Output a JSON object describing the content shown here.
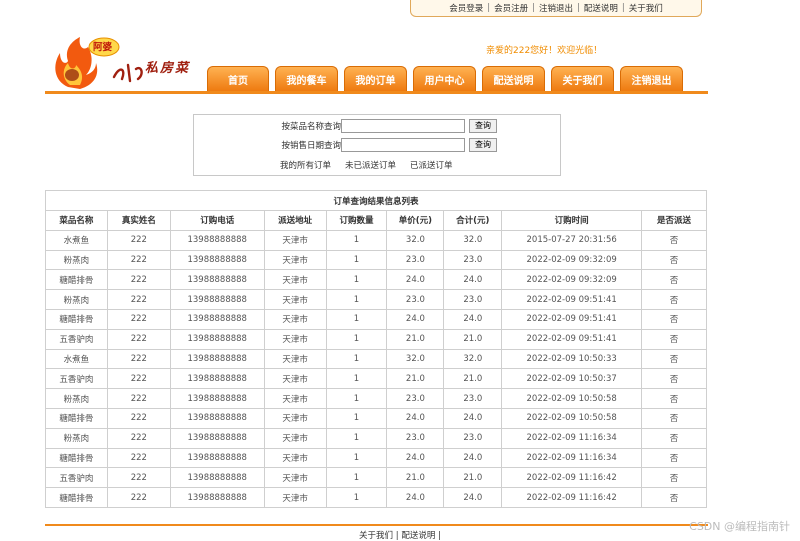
{
  "top_links": [
    "会员登录",
    "会员注册",
    "注销退出",
    "配送说明",
    "关于我们"
  ],
  "logo": {
    "badge": "阿婆",
    "brand": "私房菜"
  },
  "welcome": "亲爱的222您好！欢迎光临！",
  "nav": [
    "首页",
    "我的餐车",
    "我的订单",
    "用户中心",
    "配送说明",
    "关于我们",
    "注销退出"
  ],
  "search": {
    "by_name_label": "按菜品名称查询",
    "by_date_label": "按销售日期查询",
    "name_value": "",
    "date_value": "",
    "button": "查询",
    "links": [
      "我的所有订单",
      "未已派送订单",
      "已派送订单"
    ]
  },
  "table": {
    "caption": "订单查询结果信息列表",
    "headers": [
      "菜品名称",
      "真实姓名",
      "订购电话",
      "派送地址",
      "订购数量",
      "单价(元)",
      "合计(元)",
      "订购时间",
      "是否派送"
    ],
    "rows": [
      [
        "水煮鱼",
        "222",
        "13988888888",
        "天津市",
        "1",
        "32.0",
        "32.0",
        "2015-07-27 20:31:56",
        "否"
      ],
      [
        "粉蒸肉",
        "222",
        "13988888888",
        "天津市",
        "1",
        "23.0",
        "23.0",
        "2022-02-09 09:32:09",
        "否"
      ],
      [
        "糖醋排骨",
        "222",
        "13988888888",
        "天津市",
        "1",
        "24.0",
        "24.0",
        "2022-02-09 09:32:09",
        "否"
      ],
      [
        "粉蒸肉",
        "222",
        "13988888888",
        "天津市",
        "1",
        "23.0",
        "23.0",
        "2022-02-09 09:51:41",
        "否"
      ],
      [
        "糖醋排骨",
        "222",
        "13988888888",
        "天津市",
        "1",
        "24.0",
        "24.0",
        "2022-02-09 09:51:41",
        "否"
      ],
      [
        "五香驴肉",
        "222",
        "13988888888",
        "天津市",
        "1",
        "21.0",
        "21.0",
        "2022-02-09 09:51:41",
        "否"
      ],
      [
        "水煮鱼",
        "222",
        "13988888888",
        "天津市",
        "1",
        "32.0",
        "32.0",
        "2022-02-09 10:50:33",
        "否"
      ],
      [
        "五香驴肉",
        "222",
        "13988888888",
        "天津市",
        "1",
        "21.0",
        "21.0",
        "2022-02-09 10:50:37",
        "否"
      ],
      [
        "粉蒸肉",
        "222",
        "13988888888",
        "天津市",
        "1",
        "23.0",
        "23.0",
        "2022-02-09 10:50:58",
        "否"
      ],
      [
        "糖醋排骨",
        "222",
        "13988888888",
        "天津市",
        "1",
        "24.0",
        "24.0",
        "2022-02-09 10:50:58",
        "否"
      ],
      [
        "粉蒸肉",
        "222",
        "13988888888",
        "天津市",
        "1",
        "23.0",
        "23.0",
        "2022-02-09 11:16:34",
        "否"
      ],
      [
        "糖醋排骨",
        "222",
        "13988888888",
        "天津市",
        "1",
        "24.0",
        "24.0",
        "2022-02-09 11:16:34",
        "否"
      ],
      [
        "五香驴肉",
        "222",
        "13988888888",
        "天津市",
        "1",
        "21.0",
        "21.0",
        "2022-02-09 11:16:42",
        "否"
      ],
      [
        "糖醋排骨",
        "222",
        "13988888888",
        "天津市",
        "1",
        "24.0",
        "24.0",
        "2022-02-09 11:16:42",
        "否"
      ]
    ]
  },
  "footer_links": [
    "关于我们",
    "配送说明"
  ],
  "watermark": "CSDN @编程指南针",
  "colors": {
    "accent": "#f08a1c",
    "nav_top": "#ffb252",
    "nav_bottom": "#ee7a10",
    "welcome": "#f08c00"
  }
}
